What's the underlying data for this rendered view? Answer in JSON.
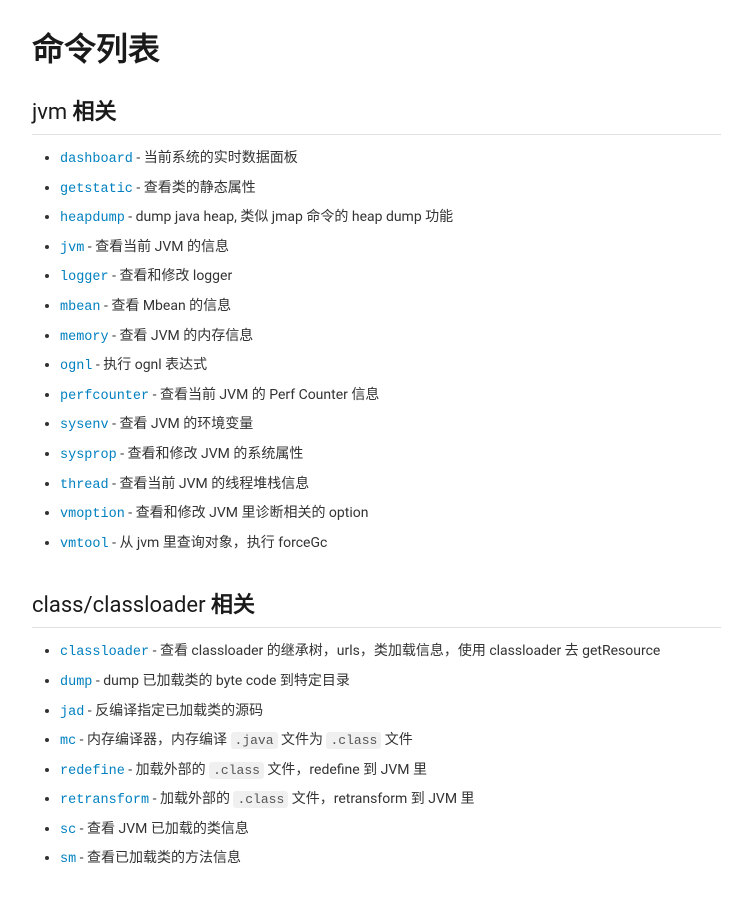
{
  "page": {
    "title": "命令列表"
  },
  "sections": [
    {
      "id": "jvm",
      "keyword": "jvm",
      "label": "相关",
      "commands": [
        {
          "name": "dashboard",
          "desc": "当前系统的实时数据面板",
          "inline_codes": []
        },
        {
          "name": "getstatic",
          "desc": "查看类的静态属性",
          "inline_codes": []
        },
        {
          "name": "heapdump",
          "desc": "dump java heap, 类似 jmap 命令的 heap dump 功能",
          "inline_codes": []
        },
        {
          "name": "jvm",
          "desc": "查看当前 JVM 的信息",
          "inline_codes": []
        },
        {
          "name": "logger",
          "desc": "查看和修改 logger",
          "inline_codes": []
        },
        {
          "name": "mbean",
          "desc": "查看 Mbean 的信息",
          "inline_codes": []
        },
        {
          "name": "memory",
          "desc": "查看 JVM 的内存信息",
          "inline_codes": []
        },
        {
          "name": "ognl",
          "desc": "执行 ognl 表达式",
          "inline_codes": []
        },
        {
          "name": "perfcounter",
          "desc": "查看当前 JVM 的 Perf Counter 信息",
          "inline_codes": []
        },
        {
          "name": "sysenv",
          "desc": "查看 JVM 的环境变量",
          "inline_codes": []
        },
        {
          "name": "sysprop",
          "desc": "查看和修改 JVM 的系统属性",
          "inline_codes": []
        },
        {
          "name": "thread",
          "desc": "查看当前 JVM 的线程堆栈信息",
          "inline_codes": []
        },
        {
          "name": "vmoption",
          "desc": "查看和修改 JVM 里诊断相关的 option",
          "inline_codes": []
        },
        {
          "name": "vmtool",
          "desc": "从 jvm 里查询对象，执行 forceGc",
          "inline_codes": []
        }
      ]
    },
    {
      "id": "class-classloader",
      "keyword": "class/classloader",
      "label": "相关",
      "commands": [
        {
          "name": "classloader",
          "desc": "查看 classloader 的继承树，urls，类加载信息，使用 classloader 去 getResource",
          "inline_codes": []
        },
        {
          "name": "dump",
          "desc": "dump 已加载类的 byte code 到特定目录",
          "inline_codes": []
        },
        {
          "name": "jad",
          "desc": "反编译指定已加载类的源码",
          "inline_codes": []
        },
        {
          "name": "mc",
          "desc_parts": [
            "内存编译器，内存编译 ",
            ".java",
            " 文件为 ",
            ".class",
            " 文件"
          ],
          "inline_codes": [
            ".java",
            ".class"
          ]
        },
        {
          "name": "redefine",
          "desc_parts": [
            "加载外部的 ",
            ".class",
            " 文件，redefine 到 JVM 里"
          ],
          "inline_codes": [
            ".class"
          ]
        },
        {
          "name": "retransform",
          "desc_parts": [
            "加载外部的 ",
            ".class",
            " 文件，retransform 到 JVM 里"
          ],
          "inline_codes": [
            ".class"
          ]
        },
        {
          "name": "sc",
          "desc": "查看 JVM 已加载的类信息",
          "inline_codes": []
        },
        {
          "name": "sm",
          "desc": "查看已加载类的方法信息",
          "inline_codes": []
        }
      ]
    }
  ]
}
